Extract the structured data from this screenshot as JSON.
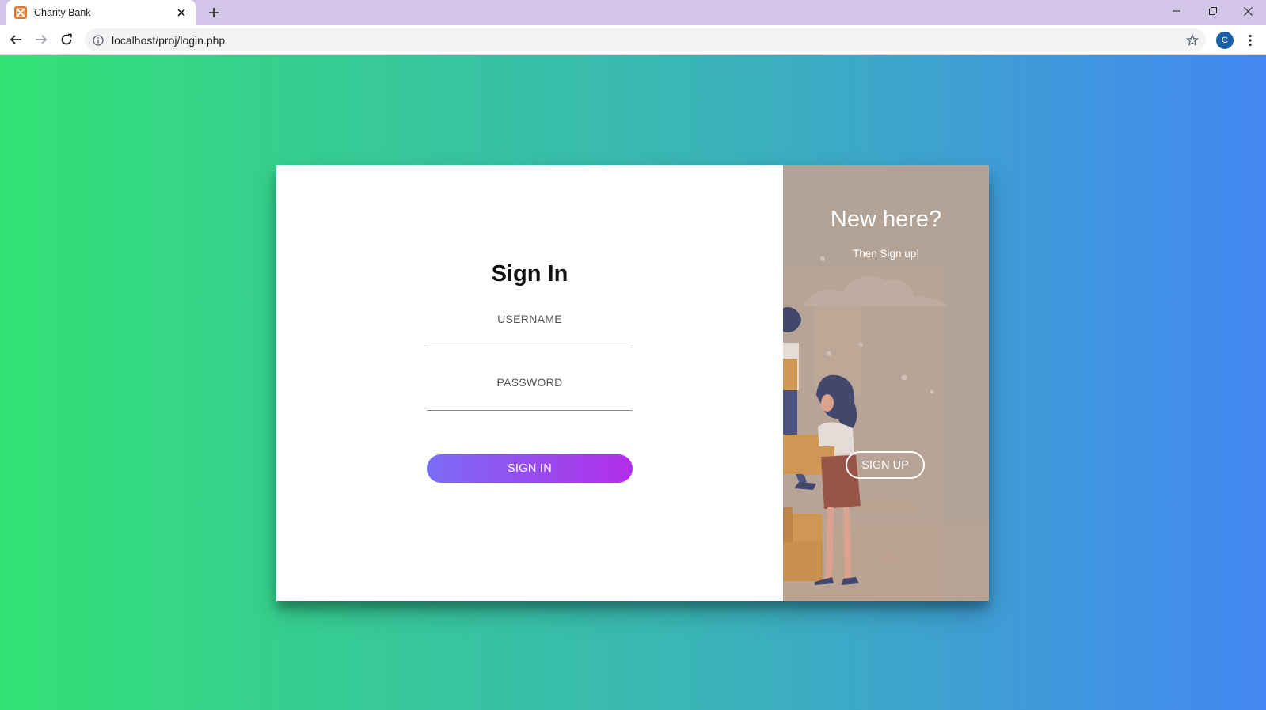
{
  "browser": {
    "tab_title": "Charity Bank",
    "url": "localhost/proj/login.php",
    "profile_initial": "C"
  },
  "signin": {
    "title": "Sign In",
    "username_label": "USERNAME",
    "password_label": "PASSWORD",
    "username_value": "",
    "password_value": "",
    "button_label": "SIGN IN"
  },
  "signup": {
    "title": "New here?",
    "subtitle": "Then Sign up!",
    "button_label": "SIGN UP"
  },
  "colors": {
    "background_gradient": [
      "#33e174",
      "#4387f2"
    ],
    "signin_button_gradient": [
      "#7b6cf6",
      "#b22ee8"
    ],
    "promo_panel": "#b3a498",
    "tab_strip": "#d3c5e8"
  },
  "icons": {
    "favicon": "xampp-icon",
    "tab_close": "close-icon",
    "new_tab": "plus-icon",
    "back": "arrow-left-icon",
    "forward": "arrow-right-icon",
    "reload": "reload-icon",
    "site_info": "info-icon",
    "bookmark": "star-icon",
    "menu": "more-vert-icon"
  }
}
